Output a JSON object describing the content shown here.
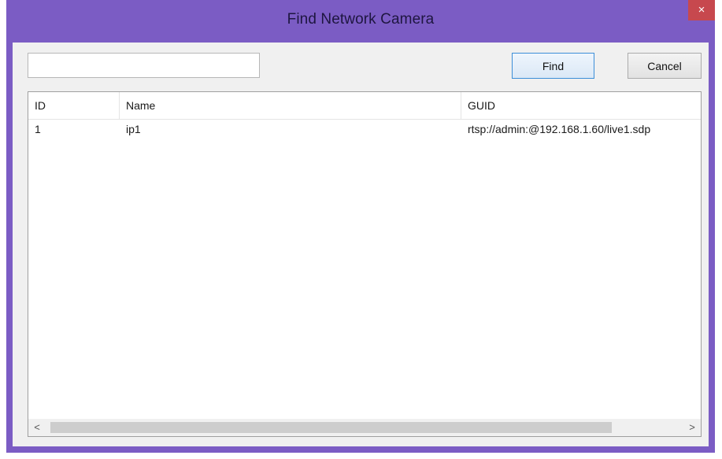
{
  "window": {
    "title": "Find Network Camera",
    "close_label": "×"
  },
  "search": {
    "value": "",
    "placeholder": ""
  },
  "buttons": {
    "find_label": "Find",
    "cancel_label": "Cancel"
  },
  "table": {
    "columns": [
      "ID",
      "Name",
      "GUID"
    ],
    "rows": [
      {
        "id": "1",
        "name": "ip1",
        "guid": "rtsp://admin:@192.168.1.60/live1.sdp"
      }
    ]
  },
  "scrollbar": {
    "left_arrow": "<",
    "right_arrow": ">"
  },
  "colors": {
    "title_bar": "#7b5cc4",
    "close_button": "#c7484e",
    "dialog_background": "#f0f0f0"
  }
}
